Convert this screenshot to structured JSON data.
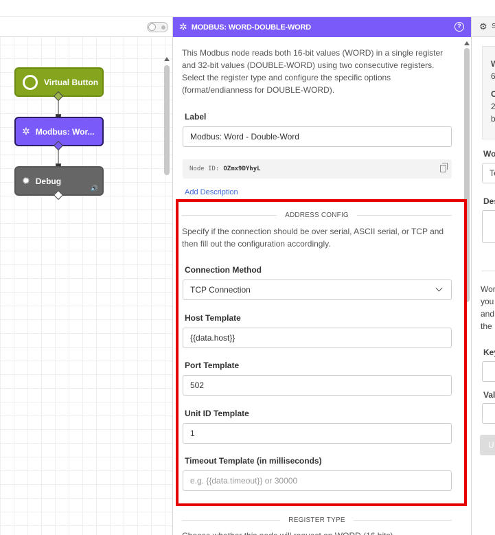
{
  "canvas": {
    "nodes": [
      {
        "label": "Virtual Button",
        "icon": "circle-icon",
        "color": "#84a51d"
      },
      {
        "label": "Modbus: Wor...",
        "icon": "modbus-icon",
        "color": "#7a5af8"
      },
      {
        "label": "Debug",
        "icon": "bug-icon",
        "color": "#666666"
      }
    ]
  },
  "panel": {
    "title": "MODBUS: WORD-DOUBLE-WORD",
    "help_icon": "?",
    "description": "This Modbus node reads both 16-bit values (WORD) in a single register and 32-bit values (DOUBLE-WORD) using two consecutive registers. Select the register type and configure the specific options (format/endianness for DOUBLE-WORD).",
    "label_field": {
      "label": "Label",
      "value": "Modbus: Word - Double-Word"
    },
    "node_id": {
      "prefix": "Node ID:",
      "value": "OZmx9DYhyL"
    },
    "add_description": "Add Description",
    "address_config": {
      "heading": "ADDRESS CONFIG",
      "description": "Specify if the connection should be over serial, ASCII serial, or TCP and then fill out the configuration accordingly.",
      "connection_method": {
        "label": "Connection Method",
        "value": "TCP Connection"
      },
      "host_template": {
        "label": "Host Template",
        "value": "{{data.host}}"
      },
      "port_template": {
        "label": "Port Template",
        "value": "502"
      },
      "unit_id_template": {
        "label": "Unit ID Template",
        "value": "1"
      },
      "timeout_template": {
        "label": "Timeout Template (in milliseconds)",
        "placeholder": "e.g. {{data.timeout}} or 30000"
      }
    },
    "register_type": {
      "heading": "REGISTER TYPE",
      "description": "Choose whether this node will request on WORD (16 bits) ..."
    }
  },
  "right_panel": {
    "header": "S",
    "box_lines": [
      "W",
      "6",
      "C",
      "2",
      "b"
    ],
    "labels": [
      "Wo",
      "Te",
      "Des",
      "Wor",
      "you",
      "and",
      "the",
      "Key",
      "Val",
      "U"
    ]
  },
  "colors": {
    "accent": "#7a5af8",
    "highlight": "#e60000",
    "virtual_button": "#84a51d",
    "debug": "#666666"
  }
}
